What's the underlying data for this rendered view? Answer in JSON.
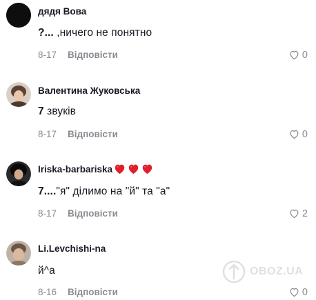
{
  "comments": [
    {
      "username": "дядя Вова",
      "text_bold": "?...",
      "text_rest": " ,ничего не понятно",
      "date": "8-17",
      "reply_label": "Відповісти",
      "likes": "0",
      "avatar_color": "#111111",
      "liked": false
    },
    {
      "username": "Валентина Жуковська",
      "text_bold": "7",
      "text_rest": " звуків",
      "date": "8-17",
      "reply_label": "Відповісти",
      "likes": "0",
      "avatar_color": "#6e5a4c",
      "liked": false
    },
    {
      "username": "Iriska-barbariska",
      "username_suffix": "heart-emoji x3",
      "text_bold": "7....",
      "text_rest": "\"я\" ділимо на \"й\" та \"а\"",
      "date": "8-17",
      "reply_label": "Відповісти",
      "likes": "2",
      "avatar_color": "#1a1a1a",
      "liked": false
    },
    {
      "username": "Li.Levchishi-na",
      "text_bold": "",
      "text_rest": "й^а",
      "date": "8-16",
      "reply_label": "Відповісти",
      "likes": "0",
      "avatar_color": "#9a8878",
      "liked": false
    }
  ],
  "icons": {
    "like": "heart-outline-icon",
    "emoji": "red-heart-icon"
  },
  "colors": {
    "text": "#161823",
    "muted": "#8a8b91",
    "heart_emoji": "#e0202c"
  },
  "watermark": {
    "text": "OBOZ.UA"
  }
}
